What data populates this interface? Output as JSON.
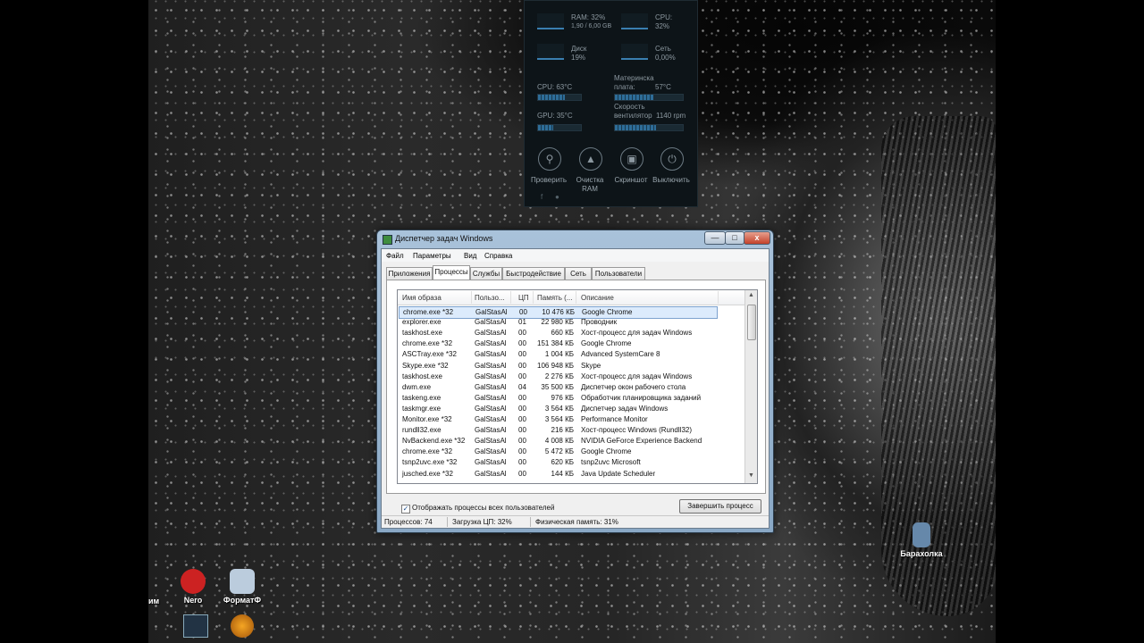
{
  "gadget": {
    "ram_label": "RAM: 32%",
    "ram_detail": "1,90 / 6,00 GB",
    "cpu_label": "CPU:",
    "cpu_value": "32%",
    "disk_label": "Диск",
    "disk_value": "19%",
    "net_label": "Сеть",
    "net_value": "0,00%",
    "cpu_temp": "CPU:  63°C",
    "mb_label_1": "Материнска",
    "mb_label_2": "плата:",
    "mb_temp": "57°C",
    "gpu_temp": "GPU:  35°C",
    "fan_label_1": "Скорость",
    "fan_label_2": "вентилятор",
    "fan_value": "1140 rpm",
    "btn_check": "Проверить",
    "btn_clean_1": "Очистка",
    "btn_clean_2": "RAM",
    "btn_screenshot": "Скриншот",
    "btn_power": "Выключить",
    "cpu_temp_level": 0.63,
    "mb_temp_level": 0.57,
    "gpu_temp_level": 0.35,
    "fan_level": 0.6
  },
  "desktop": {
    "icons": [
      {
        "label": "Nero",
        "color": "#c22"
      },
      {
        "label": "ФорматФ",
        "color": "#bcd"
      },
      {
        "label": "Барахолка",
        "color": "#68a"
      }
    ],
    "partial_label": "им"
  },
  "window": {
    "title": "Диспетчер задач Windows",
    "btn_minimize": "—",
    "btn_maximize": "□",
    "btn_close": "x",
    "menu": [
      "Файл",
      "Параметры",
      "Вид",
      "Справка"
    ],
    "tabs": [
      "Приложения",
      "Процессы",
      "Службы",
      "Быстродействие",
      "Сеть",
      "Пользователи"
    ],
    "active_tab": "Процессы",
    "columns": [
      "Имя образа",
      "Пользо...",
      "ЦП",
      "Память (...",
      "Описание"
    ],
    "rows": [
      [
        "chrome.exe *32",
        "GalStasAl",
        "00",
        "10 476 КБ",
        "Google Chrome"
      ],
      [
        "explorer.exe",
        "GalStasAl",
        "01",
        "22 980 КБ",
        "Проводник"
      ],
      [
        "taskhost.exe",
        "GalStasAl",
        "00",
        "660 КБ",
        "Хост-процесс для задач Windows"
      ],
      [
        "chrome.exe *32",
        "GalStasAl",
        "00",
        "151 384 КБ",
        "Google Chrome"
      ],
      [
        "ASCTray.exe *32",
        "GalStasAl",
        "00",
        "1 004 КБ",
        "Advanced SystemCare 8"
      ],
      [
        "Skype.exe *32",
        "GalStasAl",
        "00",
        "106 948 КБ",
        "Skype"
      ],
      [
        "taskhost.exe",
        "GalStasAl",
        "00",
        "2 276 КБ",
        "Хост-процесс для задач Windows"
      ],
      [
        "dwm.exe",
        "GalStasAl",
        "04",
        "35 500 КБ",
        "Диспетчер окон рабочего стола"
      ],
      [
        "taskeng.exe",
        "GalStasAl",
        "00",
        "976 КБ",
        "Обработчик планировщика заданий"
      ],
      [
        "taskmgr.exe",
        "GalStasAl",
        "00",
        "3 564 КБ",
        "Диспетчер задач Windows"
      ],
      [
        "Monitor.exe *32",
        "GalStasAl",
        "00",
        "3 564 КБ",
        "Performance Monitor"
      ],
      [
        "rundll32.exe",
        "GalStasAl",
        "00",
        "216 КБ",
        "Хост-процесс Windows (Rundll32)"
      ],
      [
        "NvBackend.exe *32",
        "GalStasAl",
        "00",
        "4 008 КБ",
        "NVIDIA GeForce Experience Backend"
      ],
      [
        "chrome.exe *32",
        "GalStasAl",
        "00",
        "5 472 КБ",
        "Google Chrome"
      ],
      [
        "tsnp2uvc.exe *32",
        "GalStasAl",
        "00",
        "620 КБ",
        "tsnp2uvc Microsoft"
      ],
      [
        "jusched.exe *32",
        "GalStasAl",
        "00",
        "144 КБ",
        "Java Update Scheduler"
      ]
    ],
    "show_all_label": "Отображать процессы всех пользователей",
    "end_process": "Завершить процесс",
    "status": {
      "processes": "Процессов: 74",
      "cpu": "Загрузка ЦП: 32%",
      "memory": "Физическая память: 31%"
    }
  }
}
